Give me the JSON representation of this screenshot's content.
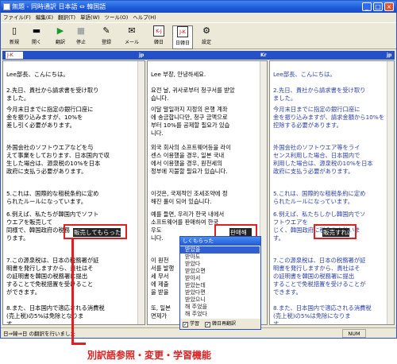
{
  "window": {
    "title": "無題 - 同時通訳 日本語 ⇔ 韓国語",
    "min": "_",
    "max": "□",
    "close": "×"
  },
  "menu": [
    "ファイル(F)",
    "編集(E)",
    "翻訳(T)",
    "単語(W)",
    "ツール(O)",
    "ヘルプ(H)"
  ],
  "toolbar": [
    {
      "label": "新規",
      "icon": "new-document-icon",
      "glyph": "▯"
    },
    {
      "label": "開く",
      "icon": "open-folder-icon",
      "glyph": "▬"
    },
    {
      "label": "翻訳",
      "icon": "play-icon",
      "glyph": "▶"
    },
    {
      "label": "停止",
      "icon": "stop-icon",
      "glyph": "■"
    },
    {
      "label": "登録",
      "icon": "register-icon",
      "glyph": "✎"
    },
    {
      "label": "メール",
      "icon": "mail-icon",
      "glyph": "✉"
    },
    {
      "label": "韓日",
      "icon": "korean-japanese-icon",
      "glyph": "K-J"
    },
    {
      "label": "日韓日",
      "icon": "japanese-korean-japanese-icon",
      "glyph": "J-K"
    },
    {
      "label": "設定",
      "icon": "settings-icon",
      "glyph": "⚙"
    }
  ],
  "langbar": {
    "selector": "J-K",
    "tag1": "jp",
    "tag2": "Kr",
    "tag3": "jp"
  },
  "pane_jp": [
    [
      "Lee部長、こんにちは。"
    ],
    [
      "2.先日、貴社から請求書を受け取り",
      "ました。"
    ],
    [
      "今月末日までに指定の銀行口座に",
      "金を振り込みますが、10%を",
      "差し引く必要があります。"
    ],
    [
      "外国会社のソフトウエアなどを与",
      "えて事業をしております、日本国内で収",
      "生した場合は、源泉税の10%を日本",
      "政府に支払う必要があります。"
    ],
    [
      "5.これは、国際的な租税条約に定め",
      "られたルールになっています。"
    ],
    [
      "6.例えば、私たちが韓国内でソフト",
      "ウエアを販売して",
      "同様で、韓国政府の税務",
      "ります。"
    ],
    [
      "7.この源泉税は、日本の税務署が証",
      "明書を発行しますから、貴社はそ",
      "の証明書を韓国の税務署に提出",
      "することで免税措置を受けること",
      "ができます。"
    ],
    [
      "8.また、日本国内で適応される消費税",
      "(売上税)の5%は免除となりま",
      "す。"
    ]
  ],
  "pane_kr": [
    [
      "Lee 부장, 안녕하세요."
    ],
    [
      "요전 날, 귀사로부터 청구서를 받았",
      "습니다."
    ],
    [
      "이달 말일까지 지정의 은행 계좌",
      "에 송금합니다만, 청구 금액으로",
      "부터 10%를 공제할 필요가 있습",
      "니다."
    ],
    [
      "외국 회사의 소프트웨어등을 라이",
      "센스 이용했을 경우, 일본 국내",
      "에서 이용했을 경우, 원천세의",
      "정부에 지불할 필요가 있습니다."
    ],
    [
      "이것은, 국제적인 조세조약에 정",
      "해진 룰이 되어 있습니다."
    ],
    [
      "예를 들면, 우리가 한국 내에서",
      "소프트웨어를 판매하여 한국",
      "우도",
      "니다."
    ],
    [
      "이 원천",
      "서를 발행",
      "세 무서",
      "에 제출",
      "을 받을"
    ],
    [
      "또, 일본",
      "면제가"
    ]
  ],
  "pane_jp2": [
    [
      "Lee部長、こんにちは。"
    ],
    [
      "2.先日、貴社から請求書を受け取り",
      "ました。"
    ],
    [
      "今月末日までに指定の銀行口座に",
      "金を振り込みますが、請求金額から10%を",
      "控除する必要があります。"
    ],
    [
      "外国会社のソフトウエア等をライ",
      "センス利用した場合、日本国内で",
      "利用した場合は、源泉税の10%を日本",
      "政府に支払う必要があります。"
    ],
    [
      "5.これは、国際的な租税条約に定め",
      "られたルールになっています。"
    ],
    [
      "6.例えば、私たちしかし韓国内でソ",
      "フトウエアを",
      "じく、韓国政府に税金を支払いま",
      "す。"
    ],
    [
      "7.この源泉税は、日本の税務署が証",
      "明書を発行しますから、貴社はそ",
      "の証明書を韓国の税務署に提出",
      "することで免税措置を受けることが",
      "できます。"
    ],
    [
      "8.また、日本国内で適応される消費税",
      "(売上税)の5%は免除になりま",
      "す。"
    ]
  ],
  "highlights": {
    "jp": "販売してもらった",
    "kr": "판매해",
    "jp2": "販売すれば"
  },
  "popup": {
    "header": "しくもらった",
    "items": [
      "받았을",
      "받아도",
      "받았다",
      "받았으면",
      "받아서",
      "받았는데",
      "받았다면",
      "받았으니",
      "해 주었을",
      "해 주었다"
    ],
    "active_index": 0,
    "footer_learn": "学習",
    "footer_reretranslate": "韓日再翻訳"
  },
  "status": {
    "text": "日⇒韓⇒日 の翻訳を行いました",
    "num": "NUM"
  },
  "caption": "別訳語参照・変更・学習機能"
}
